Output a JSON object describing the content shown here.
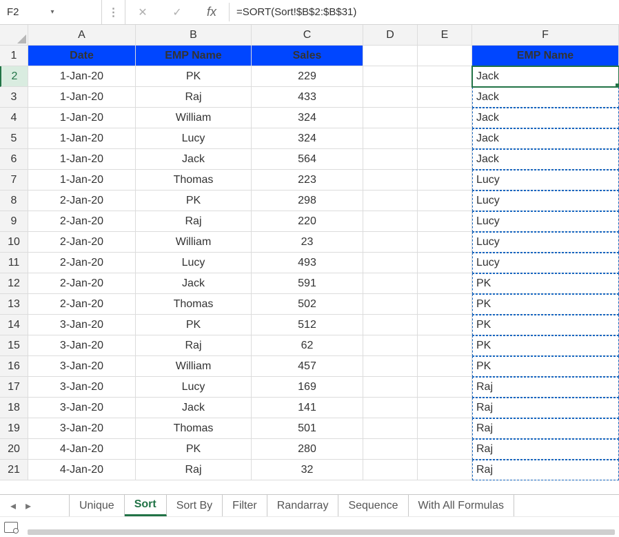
{
  "name_box": {
    "value": "F2"
  },
  "formula": "=SORT(Sort!$B$2:$B$31)",
  "columns": [
    "A",
    "B",
    "C",
    "D",
    "E",
    "F"
  ],
  "row_headers": [
    "1",
    "2",
    "3",
    "4",
    "5",
    "6",
    "7",
    "8",
    "9",
    "10",
    "11",
    "12",
    "13",
    "14",
    "15",
    "16",
    "17",
    "18",
    "19",
    "20",
    "21"
  ],
  "headers": {
    "date": "Date",
    "emp": "EMP Name",
    "sales": "Sales",
    "emp2": "EMP Name"
  },
  "rows": [
    {
      "date": "1-Jan-20",
      "emp": "PK",
      "sales": "229",
      "emp2": "Jack"
    },
    {
      "date": "1-Jan-20",
      "emp": "Raj",
      "sales": "433",
      "emp2": "Jack"
    },
    {
      "date": "1-Jan-20",
      "emp": "William",
      "sales": "324",
      "emp2": "Jack"
    },
    {
      "date": "1-Jan-20",
      "emp": "Lucy",
      "sales": "324",
      "emp2": "Jack"
    },
    {
      "date": "1-Jan-20",
      "emp": "Jack",
      "sales": "564",
      "emp2": "Jack"
    },
    {
      "date": "1-Jan-20",
      "emp": "Thomas",
      "sales": "223",
      "emp2": "Lucy"
    },
    {
      "date": "2-Jan-20",
      "emp": "PK",
      "sales": "298",
      "emp2": "Lucy"
    },
    {
      "date": "2-Jan-20",
      "emp": "Raj",
      "sales": "220",
      "emp2": "Lucy"
    },
    {
      "date": "2-Jan-20",
      "emp": "William",
      "sales": "23",
      "emp2": "Lucy"
    },
    {
      "date": "2-Jan-20",
      "emp": "Lucy",
      "sales": "493",
      "emp2": "Lucy"
    },
    {
      "date": "2-Jan-20",
      "emp": "Jack",
      "sales": "591",
      "emp2": "PK"
    },
    {
      "date": "2-Jan-20",
      "emp": "Thomas",
      "sales": "502",
      "emp2": "PK"
    },
    {
      "date": "3-Jan-20",
      "emp": "PK",
      "sales": "512",
      "emp2": "PK"
    },
    {
      "date": "3-Jan-20",
      "emp": "Raj",
      "sales": "62",
      "emp2": "PK"
    },
    {
      "date": "3-Jan-20",
      "emp": "William",
      "sales": "457",
      "emp2": "PK"
    },
    {
      "date": "3-Jan-20",
      "emp": "Lucy",
      "sales": "169",
      "emp2": "Raj"
    },
    {
      "date": "3-Jan-20",
      "emp": "Jack",
      "sales": "141",
      "emp2": "Raj"
    },
    {
      "date": "3-Jan-20",
      "emp": "Thomas",
      "sales": "501",
      "emp2": "Raj"
    },
    {
      "date": "4-Jan-20",
      "emp": "PK",
      "sales": "280",
      "emp2": "Raj"
    },
    {
      "date": "4-Jan-20",
      "emp": "Raj",
      "sales": "32",
      "emp2": "Raj"
    }
  ],
  "tabs": [
    "Unique",
    "Sort",
    "Sort By",
    "Filter",
    "Randarray",
    "Sequence",
    "With All Formulas"
  ],
  "active_tab": "Sort",
  "active_row_index": 1,
  "glyphs": {
    "chevron_down": "▾",
    "ellipsis_v": "⋮",
    "x": "✕",
    "check": "✓",
    "fx": "fx",
    "tri_left": "◂",
    "tri_right": "▸"
  }
}
